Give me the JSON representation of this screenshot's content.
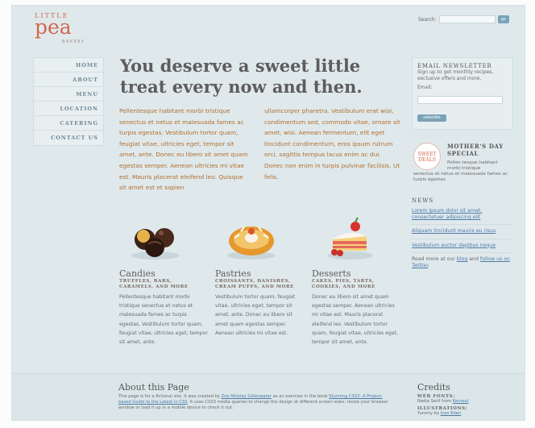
{
  "logo": {
    "top": "LITTLE",
    "main": "pea",
    "bottom": "BAKERY"
  },
  "search": {
    "label": "Search:",
    "placeholder": "",
    "button": "go"
  },
  "nav": [
    "HOME",
    "ABOUT",
    "MENU",
    "LOCATION",
    "CATERING",
    "CONTACT US"
  ],
  "hero": "You deserve a sweet little treat every now and then.",
  "intro": {
    "col1": "Pellentesque habitant morbi tristique senectus et netus et malesuada fames ac turpis egestas. Vestibulum tortor quam, feugiat vitae, ultricies eget, tempor sit amet, ante. Donec eu libero sit amet quam egestas semper. Aenean ultricies mi vitae est. Mauris placerat eleifend leo. Quisque sit amet est et sapien",
    "col2": "ullamcorper pharetra. Vestibulum erat wisi, condimentum sed, commodo vitae, ornare sit amet, wisi. Aenean fermentum, elit eget tincidunt condimentum, eros ipsum rutrum orci, sagittis tempus lacus enim ac dui. Donec non enim in turpis pulvinar facilisis. Ut felis."
  },
  "categories": [
    {
      "title": "Candies",
      "subtitle": "TRUFFLES, BARS, CARAMELS, AND MORE",
      "body": "Pellentesque habitant morbi tristique senectus et netus et malesuada fames ac turpis egestas. Vestibulum tortor quam, feugiat vitae, ultricies eget, tempor sit amet, ante.",
      "icon": "chocolates-icon"
    },
    {
      "title": "Pastries",
      "subtitle": "CROISSANTS, DANISHES, CREAM PUFFS, AND MORE",
      "body": "Vestibulum tortor quam, feugiat vitae, ultricies eget, tempor sit amet, ante. Donec eu libero sit amet quam egestas semper. Aenean ultricies mi vitae est.",
      "icon": "danish-icon"
    },
    {
      "title": "Desserts",
      "subtitle": "CAKES, PIES, TARTS, COOKIES, AND MORE",
      "body": "Donec eu libero sit amet quam egestas semper. Aenean ultricies mi vitae est. Mauris placerat eleifend leo. Vestibulum tortor quam, feugiat vitae, ultricies eget, tempor sit amet, ante.",
      "icon": "cake-icon"
    }
  ],
  "newsletter": {
    "title": "EMAIL NEWSLETTER",
    "text": "Sign up to get monthly recipes, exclusive offers and more.",
    "label": "Email:",
    "button": "subscribe"
  },
  "special": {
    "badge1": "SWEET",
    "badge2": "DEALS",
    "title": "MOTHER'S DAY SPECIAL",
    "desc1": "Pellen tesque habitant morbi tristique",
    "desc2": "senectus et netus et malesuada fames ac turpis egestas."
  },
  "news": {
    "title": "NEWS",
    "items": [
      "Lorem ipsum dolor sit amet, consectetuer adipiscing elit",
      "Aliquam tincidunt mauris eu risus",
      "Vestibulum auctor dapibus neque"
    ],
    "more_prefix": "Read more at our",
    "blog": "blog",
    "and": "and",
    "twitter": "follow us on Twitter",
    "suffix": "."
  },
  "footer": {
    "about_title": "About this Page",
    "about_p1": "This page is for a fictional site. It was created by",
    "author": "Zoe Mickley Gillenwater",
    "about_p2": "as an exercise in the book",
    "book": "Stunning CSS3: A Project-based Guide to the Latest in CSS",
    "about_p3": ". It uses CSS3 media queries to change the design at different screen sizes: resize your browser window or load it up in a mobile device to check it out.",
    "credits_title": "Credits",
    "webfonts_label": "WEB FONTS:",
    "webfonts_text": "Nadia Serif from",
    "webfonts_link": "Kernest",
    "illustrations_label": "ILLUSTRATIONS:",
    "illustrations_text": "Yummy by",
    "illustrations_link": "Icon Eden"
  }
}
